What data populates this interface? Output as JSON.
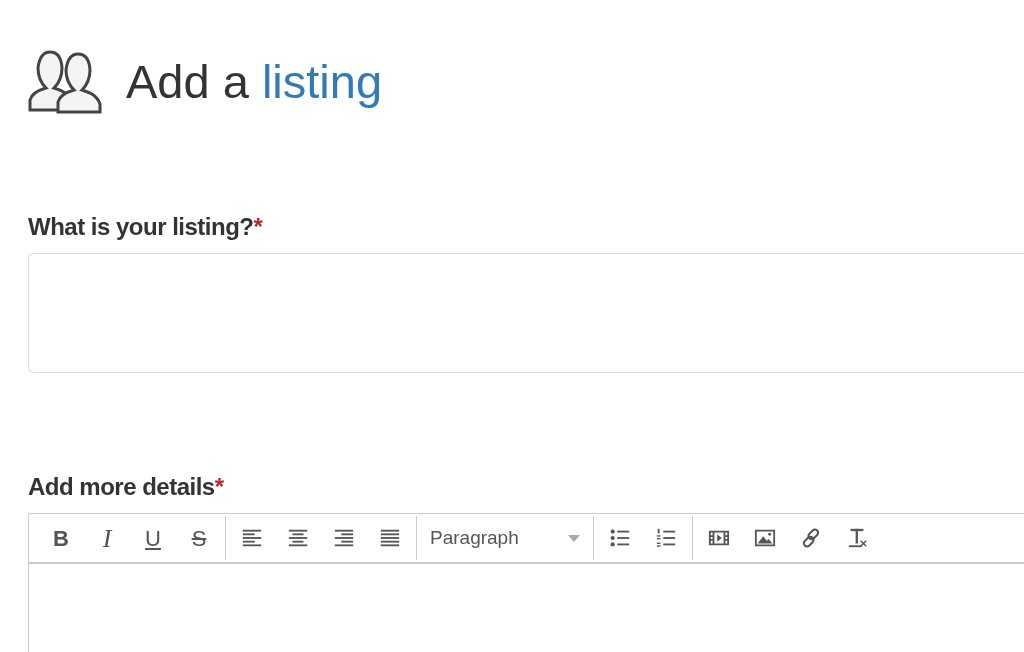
{
  "header": {
    "title": "Add a",
    "title_highlight": "listing"
  },
  "fields": [
    {
      "label": "What is your listing?",
      "required_mark": "*",
      "kind": "text"
    },
    {
      "label": "Add more details",
      "required_mark": "*",
      "kind": "editor"
    }
  ],
  "toolbar": {
    "groups": [
      [
        {
          "kind": "bold",
          "label": "B"
        },
        {
          "kind": "italic",
          "label": "I"
        },
        {
          "kind": "underline",
          "label": "U"
        },
        {
          "kind": "strike",
          "label": "S"
        }
      ],
      [
        {
          "kind": "align-left"
        },
        {
          "kind": "align-center"
        },
        {
          "kind": "align-right"
        },
        {
          "kind": "justify"
        }
      ],
      [
        {
          "kind": "dropdown",
          "label": "Paragraph"
        }
      ],
      [
        {
          "kind": "bullet-list"
        },
        {
          "kind": "numbered-list"
        }
      ],
      [
        {
          "kind": "video"
        },
        {
          "kind": "image"
        },
        {
          "kind": "link"
        },
        {
          "kind": "clear-format"
        }
      ]
    ]
  }
}
